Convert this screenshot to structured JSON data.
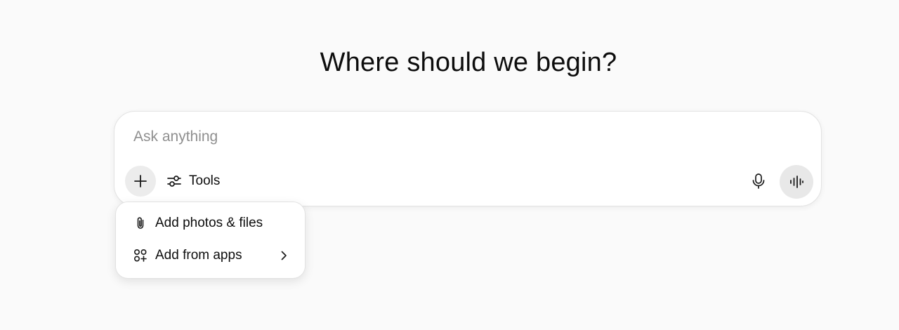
{
  "heading": "Where should we begin?",
  "composer": {
    "placeholder": "Ask anything",
    "value": "",
    "tools_label": "Tools",
    "icons": {
      "plus": "plus-icon",
      "tools": "sliders-icon",
      "mic": "microphone-icon",
      "voice": "voice-waveform-icon"
    }
  },
  "attach_menu": {
    "items": [
      {
        "label": "Add photos & files",
        "icon": "paperclip-icon"
      },
      {
        "label": "Add from apps",
        "icon": "apps-grid-plus-icon",
        "submenu_icon": "chevron-right-icon"
      }
    ]
  },
  "colors": {
    "background": "#fafafa",
    "surface": "#ffffff",
    "text": "#0d0d0d",
    "placeholder": "#8f8f8f",
    "button_bg": "#ececec"
  }
}
